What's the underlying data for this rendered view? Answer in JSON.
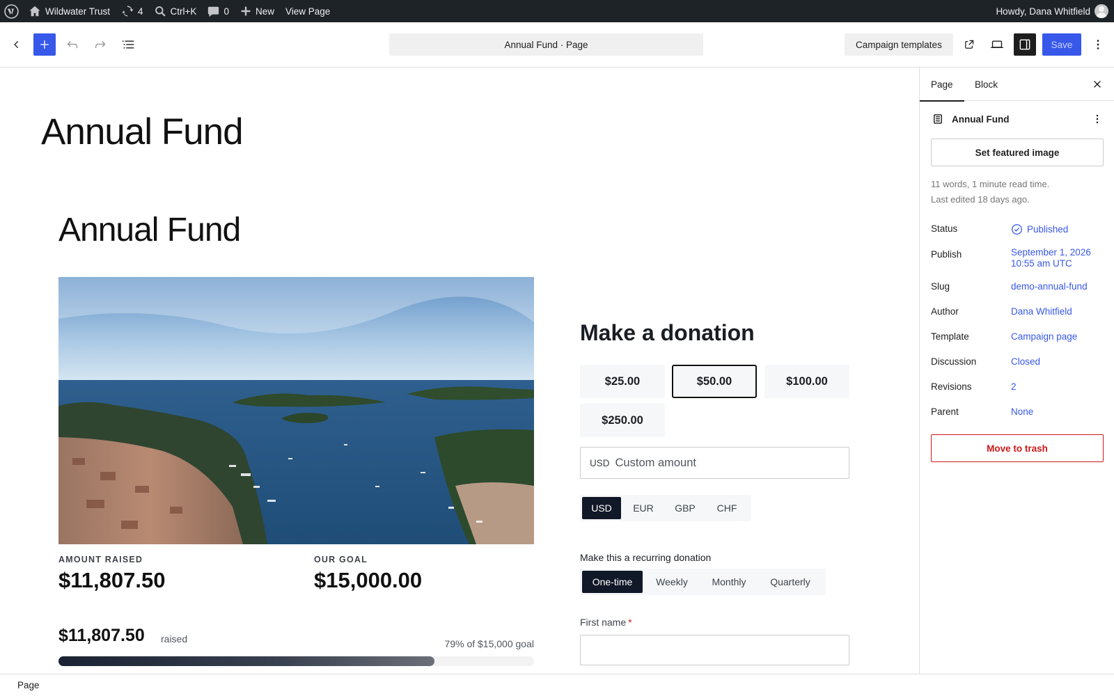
{
  "admin_bar": {
    "site_name": "Wildwater Trust",
    "updates_count": "4",
    "search_shortcut": "Ctrl+K",
    "comments_count": "0",
    "new_label": "New",
    "view_page_label": "View Page",
    "greeting": "Howdy, Dana Whitfield"
  },
  "header": {
    "document_title": "Annual Fund · Page",
    "templates_label": "Campaign templates",
    "save_label": "Save"
  },
  "canvas": {
    "page_title": "Annual Fund",
    "campaign_title": "Annual Fund",
    "stats": {
      "raised_label": "AMOUNT RAISED",
      "raised_value": "$11,807.50",
      "goal_label": "OUR GOAL",
      "goal_value": "$15,000.00"
    },
    "progress": {
      "amount": "$11,807.50",
      "raised_word": "raised",
      "summary": "79% of $15,000 goal",
      "fraction": 0.79
    },
    "donation": {
      "title": "Make a donation",
      "amounts": [
        "$25.00",
        "$50.00",
        "$100.00",
        "$250.00"
      ],
      "selected_amount": "$50.00",
      "custom_currency": "USD",
      "custom_placeholder": "Custom amount",
      "currencies": [
        "USD",
        "EUR",
        "GBP",
        "CHF"
      ],
      "selected_currency": "USD",
      "recurring_label": "Make this a recurring donation",
      "frequencies": [
        "One-time",
        "Weekly",
        "Monthly",
        "Quarterly"
      ],
      "selected_frequency": "One-time",
      "first_name_label": "First name",
      "required_mark": "*"
    }
  },
  "sidebar": {
    "tabs": [
      "Page",
      "Block"
    ],
    "active_tab": "Page",
    "doc_title": "Annual Fund",
    "featured_image_label": "Set featured image",
    "word_count": "11 words, 1 minute read time.",
    "last_edited": "Last edited 18 days ago.",
    "properties": {
      "status": {
        "label": "Status",
        "value": "Published"
      },
      "publish": {
        "label": "Publish",
        "value_line1": "September 1, 2026",
        "value_line2": "10:55 am UTC"
      },
      "slug": {
        "label": "Slug",
        "value": "demo-annual-fund"
      },
      "author": {
        "label": "Author",
        "value": "Dana Whitfield"
      },
      "template": {
        "label": "Template",
        "value": "Campaign page"
      },
      "discussion": {
        "label": "Discussion",
        "value": "Closed"
      },
      "revisions": {
        "label": "Revisions",
        "value": "2"
      },
      "parent": {
        "label": "Parent",
        "value": "None"
      }
    },
    "trash_label": "Move to trash"
  },
  "footer": {
    "breadcrumb": "Page"
  },
  "colors": {
    "accent": "#3858e9",
    "admin_bar": "#1d2327",
    "danger": "#cc1818",
    "selected_option": "#111827"
  }
}
